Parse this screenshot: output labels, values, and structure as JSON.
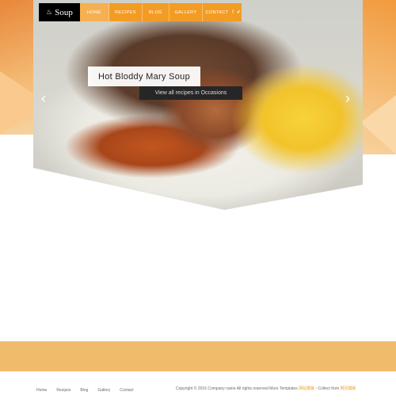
{
  "brand": {
    "name": "Soup",
    "icon": "bowl-icon"
  },
  "nav": {
    "items": [
      {
        "label": "HOME",
        "active": true
      },
      {
        "label": "RECIPES",
        "active": false
      },
      {
        "label": "BLOG",
        "active": false
      },
      {
        "label": "GALLERY",
        "active": false
      },
      {
        "label": "CONTACT",
        "active": false
      }
    ],
    "social": {
      "facebook": "f",
      "twitter": "✔"
    }
  },
  "hero": {
    "title": "Hot Bloddy Mary Soup",
    "cta": "View all recipes in Occasions",
    "prev": "‹",
    "next": "›"
  },
  "footer": {
    "links": [
      "Home",
      "Recipes",
      "Blog",
      "Gallery",
      "Contact"
    ],
    "copyright_pre": "Copyright © 2016 Company name All rights reserved More Templates ",
    "link1": "网站模板",
    "copyright_mid": " - Collect from ",
    "link2": "网页模板"
  },
  "colors": {
    "accent": "#f39c24",
    "band": "#f1bb6c",
    "logo_bg": "#000000"
  }
}
